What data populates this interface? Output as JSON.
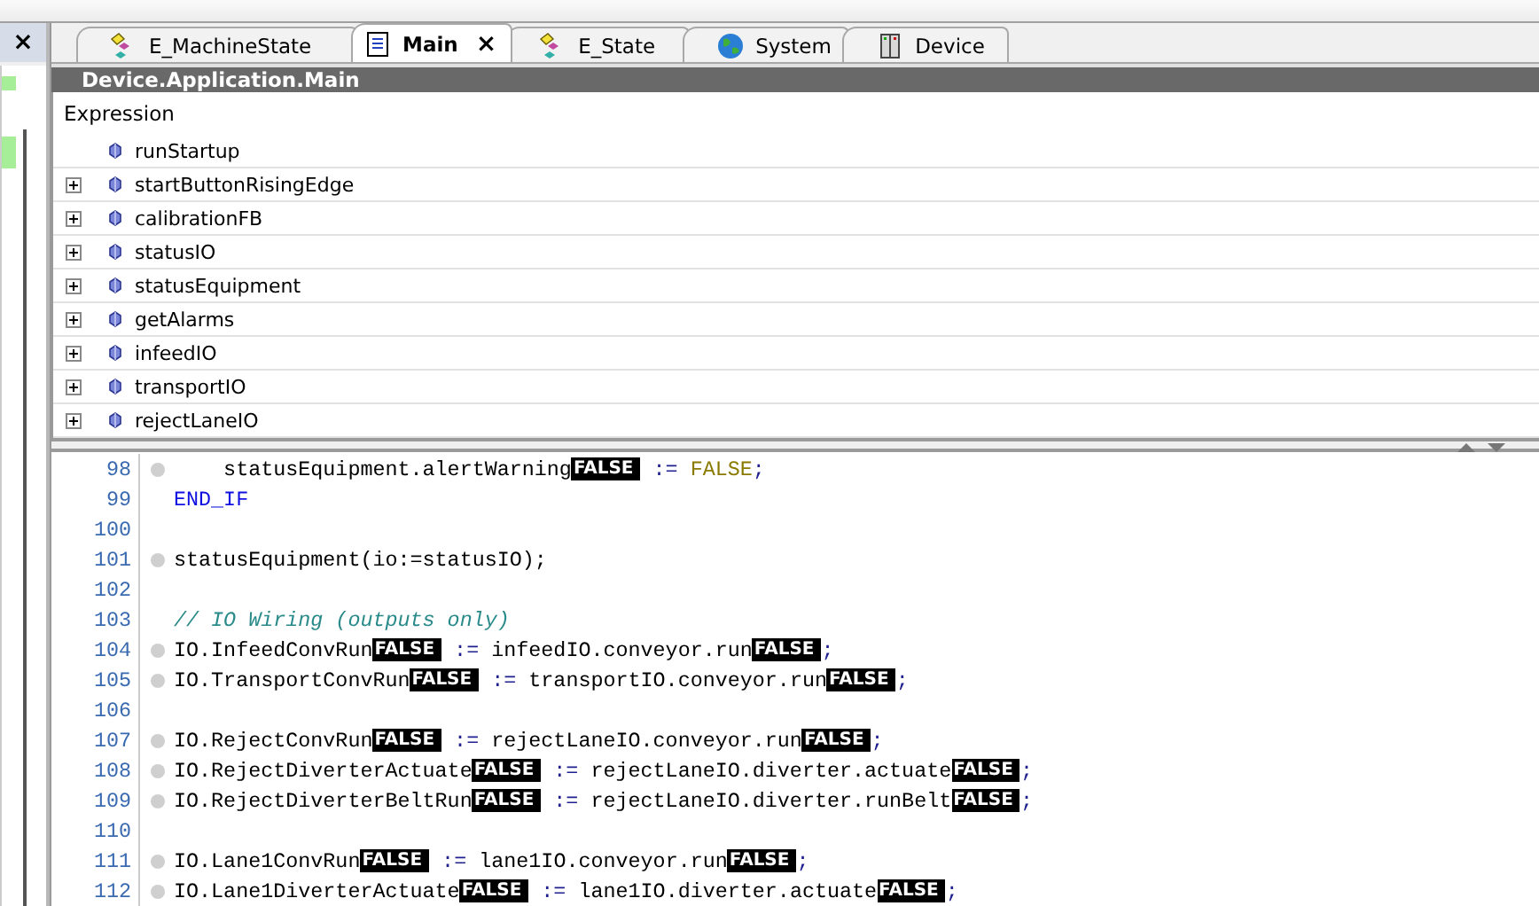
{
  "side_panel": {
    "close": "×"
  },
  "tabs": [
    {
      "label": "E_MachineState",
      "kind": "enum",
      "selected": false
    },
    {
      "label": "Main",
      "kind": "program",
      "selected": true,
      "close": "×"
    },
    {
      "label": "E_State",
      "kind": "enum",
      "selected": false
    },
    {
      "label": "System",
      "kind": "globe",
      "selected": false
    },
    {
      "label": "Device",
      "kind": "device",
      "selected": false
    }
  ],
  "header": {
    "title": "Device.Application.Main"
  },
  "watch": {
    "column": "Expression",
    "rows": [
      {
        "name": "runStartup",
        "expandable": false
      },
      {
        "name": "startButtonRisingEdge",
        "expandable": true
      },
      {
        "name": "calibrationFB",
        "expandable": true
      },
      {
        "name": "statusIO",
        "expandable": true
      },
      {
        "name": "statusEquipment",
        "expandable": true
      },
      {
        "name": "getAlarms",
        "expandable": true
      },
      {
        "name": "infeedIO",
        "expandable": true
      },
      {
        "name": "transportIO",
        "expandable": true
      },
      {
        "name": "rejectLaneIO",
        "expandable": true
      }
    ]
  },
  "code": {
    "lines": [
      {
        "number": "98",
        "breakpoint": true,
        "tokens": [
          {
            "kind": "text",
            "text": "    statusEquipment.alertWarning"
          },
          {
            "kind": "value",
            "text": "FALSE"
          },
          {
            "kind": "op",
            "text": " := "
          },
          {
            "kind": "literal",
            "text": "FALSE"
          },
          {
            "kind": "op",
            "text": ";"
          }
        ]
      },
      {
        "number": "99",
        "breakpoint": false,
        "tokens": [
          {
            "kind": "keyword",
            "text": "END_IF"
          }
        ]
      },
      {
        "number": "100",
        "breakpoint": false
      },
      {
        "number": "101",
        "breakpoint": true,
        "tokens": [
          {
            "kind": "text",
            "text": "statusEquipment(io:=statusIO);"
          }
        ]
      },
      {
        "number": "102",
        "breakpoint": false
      },
      {
        "number": "103",
        "breakpoint": false,
        "tokens": [
          {
            "kind": "comment",
            "text": "// IO Wiring (outputs only)"
          }
        ]
      },
      {
        "number": "104",
        "breakpoint": true,
        "tokens": [
          {
            "kind": "text",
            "text": "IO.InfeedConvRun"
          },
          {
            "kind": "value",
            "text": "FALSE"
          },
          {
            "kind": "op",
            "text": " := "
          },
          {
            "kind": "text",
            "text": "infeedIO.conveyor.run"
          },
          {
            "kind": "value",
            "text": "FALSE"
          },
          {
            "kind": "op",
            "text": ";"
          }
        ]
      },
      {
        "number": "105",
        "breakpoint": true,
        "tokens": [
          {
            "kind": "text",
            "text": "IO.TransportConvRun"
          },
          {
            "kind": "value",
            "text": "FALSE"
          },
          {
            "kind": "op",
            "text": " := "
          },
          {
            "kind": "text",
            "text": "transportIO.conveyor.run"
          },
          {
            "kind": "value",
            "text": "FALSE"
          },
          {
            "kind": "op",
            "text": ";"
          }
        ]
      },
      {
        "number": "106",
        "breakpoint": false
      },
      {
        "number": "107",
        "breakpoint": true,
        "tokens": [
          {
            "kind": "text",
            "text": "IO.RejectConvRun"
          },
          {
            "kind": "value",
            "text": "FALSE"
          },
          {
            "kind": "op",
            "text": " := "
          },
          {
            "kind": "text",
            "text": "rejectLaneIO.conveyor.run"
          },
          {
            "kind": "value",
            "text": "FALSE"
          },
          {
            "kind": "op",
            "text": ";"
          }
        ]
      },
      {
        "number": "108",
        "breakpoint": true,
        "tokens": [
          {
            "kind": "text",
            "text": "IO.RejectDiverterActuate"
          },
          {
            "kind": "value",
            "text": "FALSE"
          },
          {
            "kind": "op",
            "text": " := "
          },
          {
            "kind": "text",
            "text": "rejectLaneIO.diverter.actuate"
          },
          {
            "kind": "value",
            "text": "FALSE"
          },
          {
            "kind": "op",
            "text": ";"
          }
        ]
      },
      {
        "number": "109",
        "breakpoint": true,
        "tokens": [
          {
            "kind": "text",
            "text": "IO.RejectDiverterBeltRun"
          },
          {
            "kind": "value",
            "text": "FALSE"
          },
          {
            "kind": "op",
            "text": " := "
          },
          {
            "kind": "text",
            "text": "rejectLaneIO.diverter.runBelt"
          },
          {
            "kind": "value",
            "text": "FALSE"
          },
          {
            "kind": "op",
            "text": ";"
          }
        ]
      },
      {
        "number": "110",
        "breakpoint": false
      },
      {
        "number": "111",
        "breakpoint": true,
        "tokens": [
          {
            "kind": "text",
            "text": "IO.Lane1ConvRun"
          },
          {
            "kind": "value",
            "text": "FALSE"
          },
          {
            "kind": "op",
            "text": " := "
          },
          {
            "kind": "text",
            "text": "lane1IO.conveyor.run"
          },
          {
            "kind": "value",
            "text": "FALSE"
          },
          {
            "kind": "op",
            "text": ";"
          }
        ]
      },
      {
        "number": "112",
        "breakpoint": true,
        "tokens": [
          {
            "kind": "text",
            "text": "IO.Lane1DiverterActuate"
          },
          {
            "kind": "value",
            "text": "FALSE"
          },
          {
            "kind": "op",
            "text": " := "
          },
          {
            "kind": "text",
            "text": "lane1IO.diverter.actuate"
          },
          {
            "kind": "value",
            "text": "FALSE"
          },
          {
            "kind": "op",
            "text": ";"
          }
        ]
      }
    ]
  }
}
